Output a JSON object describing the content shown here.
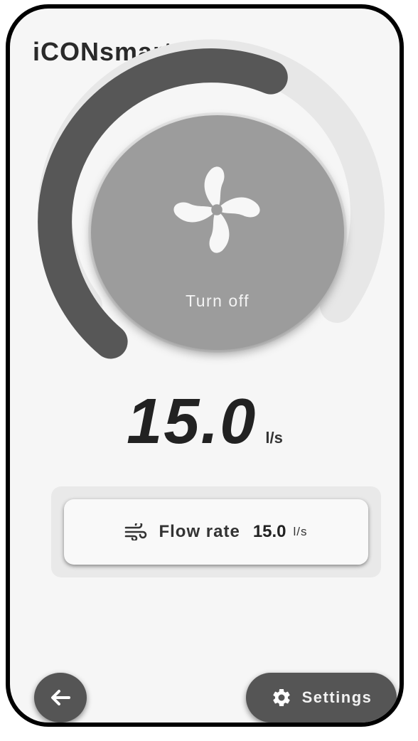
{
  "app": {
    "title": "iCONsmart 15"
  },
  "gauge": {
    "level_fraction": 0.58,
    "active_color": "#575757",
    "track_color": "#e7e7e7"
  },
  "power": {
    "label": "Turn off",
    "icon": "fan-icon"
  },
  "flow": {
    "value": "15.0",
    "unit": "l/s"
  },
  "flow_card": {
    "icon": "wind-icon",
    "label": "Flow rate",
    "value": "15.0",
    "unit": "l/s"
  },
  "nav": {
    "back_icon": "arrow-left-icon",
    "settings_icon": "gear-icon",
    "settings_label": "Settings"
  }
}
